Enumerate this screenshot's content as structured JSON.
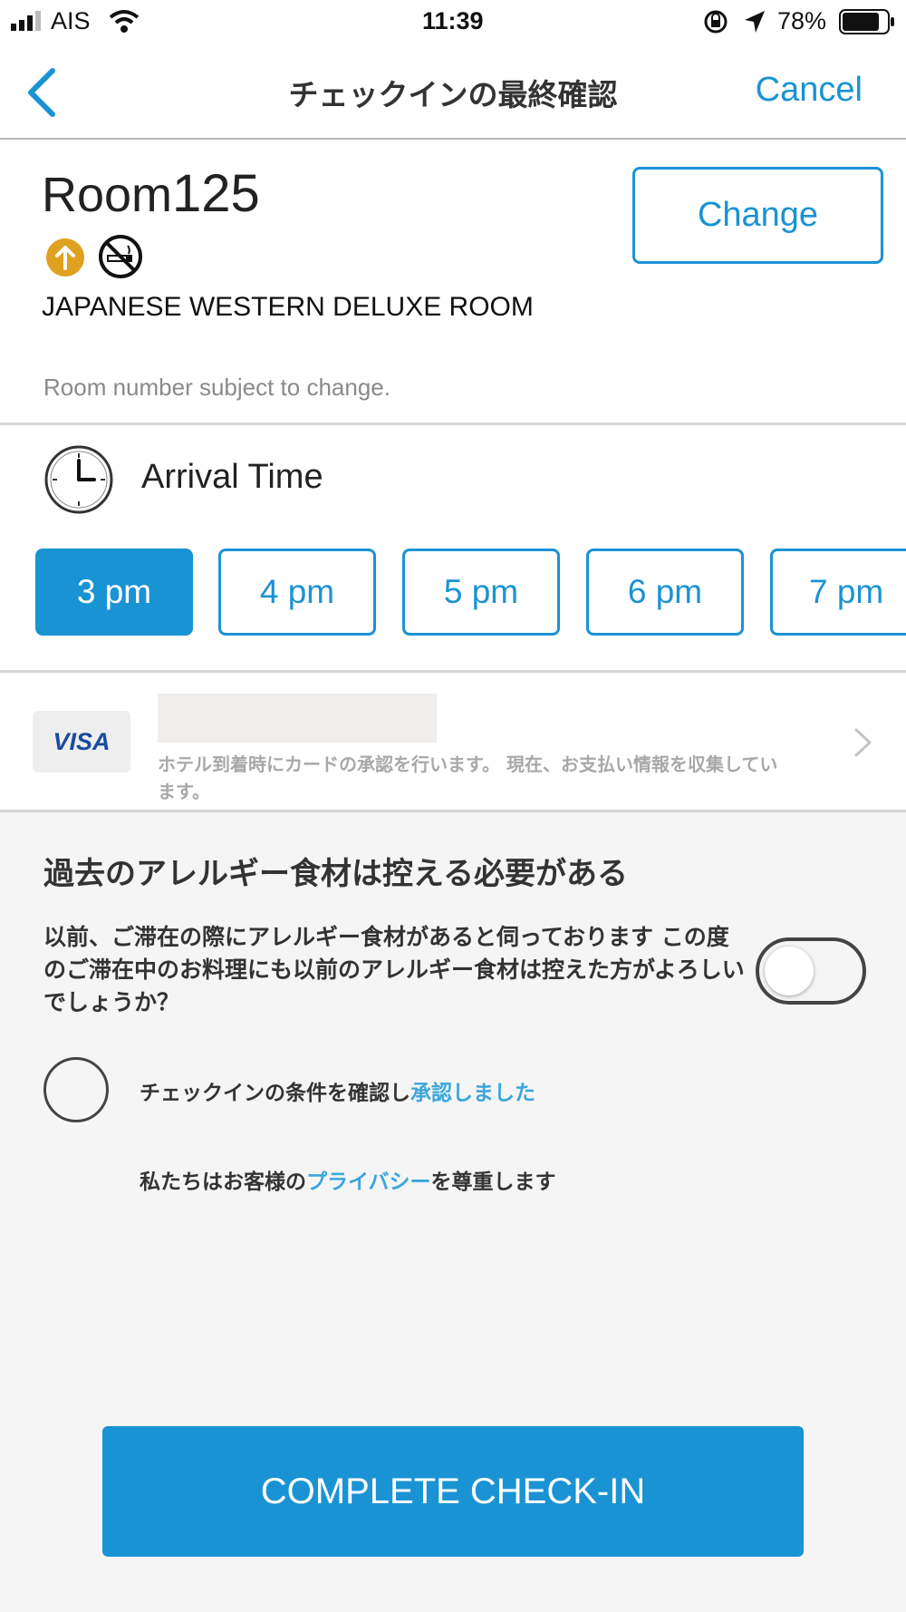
{
  "status_bar": {
    "carrier": "AIS",
    "time": "11:39",
    "battery": "78%"
  },
  "nav": {
    "title": "チェックインの最終確認",
    "cancel_label": "Cancel"
  },
  "room": {
    "title_prefix": "Room",
    "number": "125",
    "change_label": "Change",
    "type": "JAPANESE WESTERN DELUXE ROOM",
    "note": "Room number subject to change.",
    "icons": [
      "upgrade-arrow-icon",
      "no-smoking-icon"
    ]
  },
  "arrival": {
    "label": "Arrival Time",
    "times": [
      {
        "label": "3 pm",
        "selected": true
      },
      {
        "label": "4 pm",
        "selected": false
      },
      {
        "label": "5 pm",
        "selected": false
      },
      {
        "label": "6 pm",
        "selected": false
      },
      {
        "label": "7 pm",
        "selected": false
      }
    ]
  },
  "payment": {
    "card_brand": "VISA",
    "note": "ホテル到着時にカードの承認を行います。 現在、お支払い情報を収集しています。"
  },
  "allergy": {
    "heading": "過去のアレルギー食材は控える必要がある",
    "body": "以前、ご滞在の際にアレルギー食材があると伺っております この度のご滞在中のお料理にも以前のアレルギー食材は控えた方がよろしいでしょうか？",
    "toggle_on": false
  },
  "accept": {
    "text": "チェックインの条件を確認し",
    "link": "承認しました",
    "checked": false
  },
  "privacy": {
    "prefix": "私たちはお客様の",
    "link": "プライバシー",
    "suffix": "を尊重します"
  },
  "complete_label": "COMPLETE CHECK-IN",
  "colors": {
    "accent": "#1a93d4",
    "link": "#3aa6dd",
    "upgrade_icon": "#e0a020"
  }
}
